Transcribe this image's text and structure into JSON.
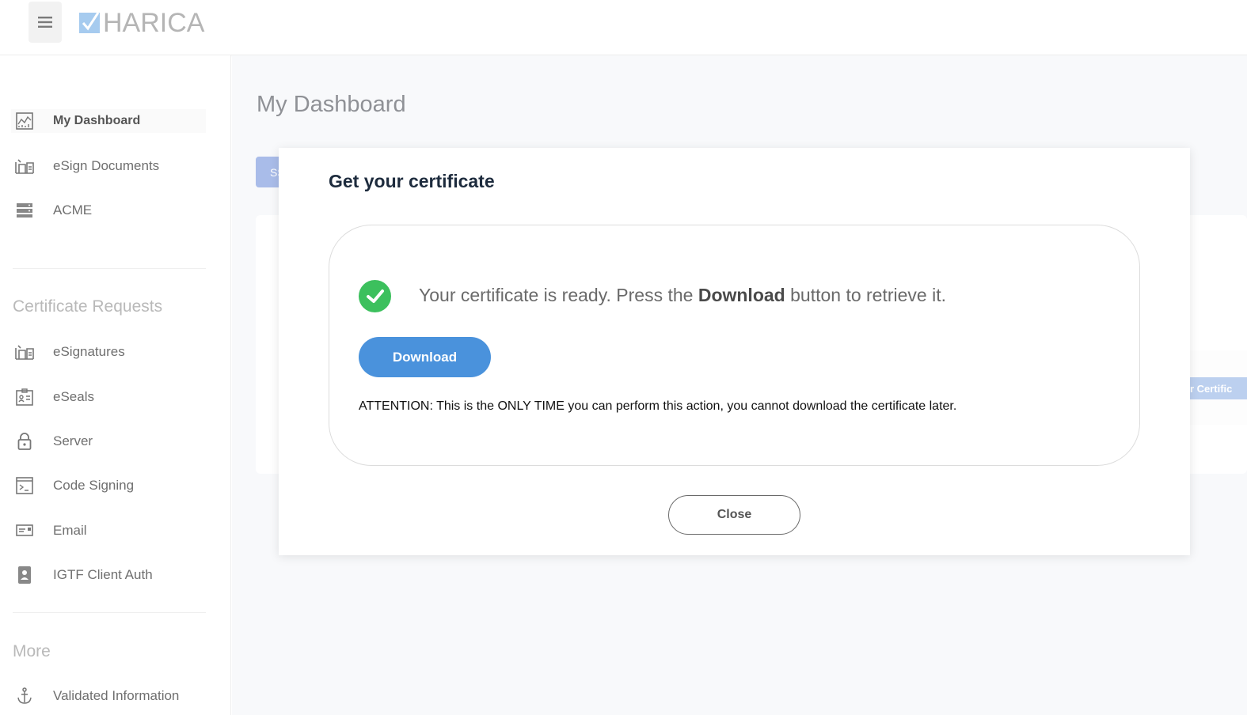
{
  "header": {
    "logo_text": "HARICA",
    "menu_icon": "hamburger-icon"
  },
  "sidebar": {
    "main_items": [
      {
        "label": "My Dashboard",
        "icon": "chart-icon",
        "active": true
      },
      {
        "label": "eSign Documents",
        "icon": "document-sign-icon"
      },
      {
        "label": "ACME",
        "icon": "server-rack-icon"
      }
    ],
    "cert_section_title": "Certificate Requests",
    "cert_items": [
      {
        "label": "eSignatures",
        "icon": "document-sign-icon"
      },
      {
        "label": "eSeals",
        "icon": "seal-icon"
      },
      {
        "label": "Server",
        "icon": "lock-icon"
      },
      {
        "label": "Code Signing",
        "icon": "terminal-icon"
      },
      {
        "label": "Email",
        "icon": "email-card-icon"
      },
      {
        "label": "IGTF Client Auth",
        "icon": "id-badge-icon"
      }
    ],
    "more_section_title": "More",
    "more_items": [
      {
        "label": "Validated Information",
        "icon": "anchor-icon"
      }
    ]
  },
  "main": {
    "page_title": "My Dashboard",
    "bg_chip_label": "SS",
    "bg_button_label": "ur Certific"
  },
  "modal": {
    "title": "Get your certificate",
    "ready_prefix": "Your certificate is ready. Press the ",
    "ready_bold": "Download",
    "ready_suffix": " button to retrieve it.",
    "download_label": "Download",
    "attention": "ATTENTION: This is the ONLY TIME you can perform this action, you cannot download the certificate later.",
    "close_label": "Close"
  },
  "colors": {
    "accent": "#4a92dc",
    "success": "#3cc05d",
    "title": "#1d2b3d"
  }
}
